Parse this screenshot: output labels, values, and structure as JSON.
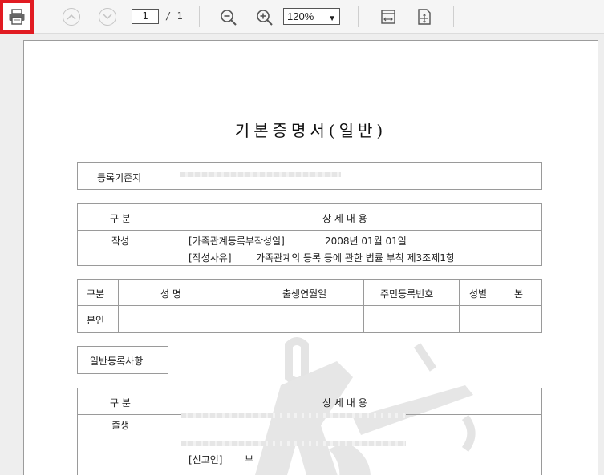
{
  "toolbar": {
    "page_current": "1",
    "page_total": "/ 1",
    "zoom_value": "120%",
    "icons": {
      "print": "printer-icon",
      "prev": "chevron-up-icon",
      "next": "chevron-down-icon",
      "zoom_out": "zoom-out-icon",
      "zoom_in": "zoom-in-icon",
      "fit_width": "fit-width-icon",
      "fit_page": "fit-page-icon"
    },
    "colors": {
      "print_highlight": "#e11b22"
    }
  },
  "document": {
    "title": "기본증명서(일반)",
    "registry": {
      "label": "등록기준지"
    },
    "section1": {
      "header_col1": "구  분",
      "header_col2": "상 세 내 용",
      "row_label": "작성",
      "line1_key": "[가족관계등록부작성일]",
      "line1_value": "2008년 01월 01일",
      "line2_key": "[작성사유]",
      "line2_value": "가족관계의 등록 등에 관한 법률 부칙 제3조제1항"
    },
    "person": {
      "headers": [
        "구분",
        "성        명",
        "출생연월일",
        "주민등록번호",
        "성별",
        "본"
      ],
      "row_label": "본인"
    },
    "general_label": "일반등록사항",
    "section2": {
      "header_col1": "구  분",
      "header_col2": "상 세 내 용",
      "row_label": "출생",
      "reporter_key": "[신고인]",
      "reporter_value": "부"
    }
  }
}
